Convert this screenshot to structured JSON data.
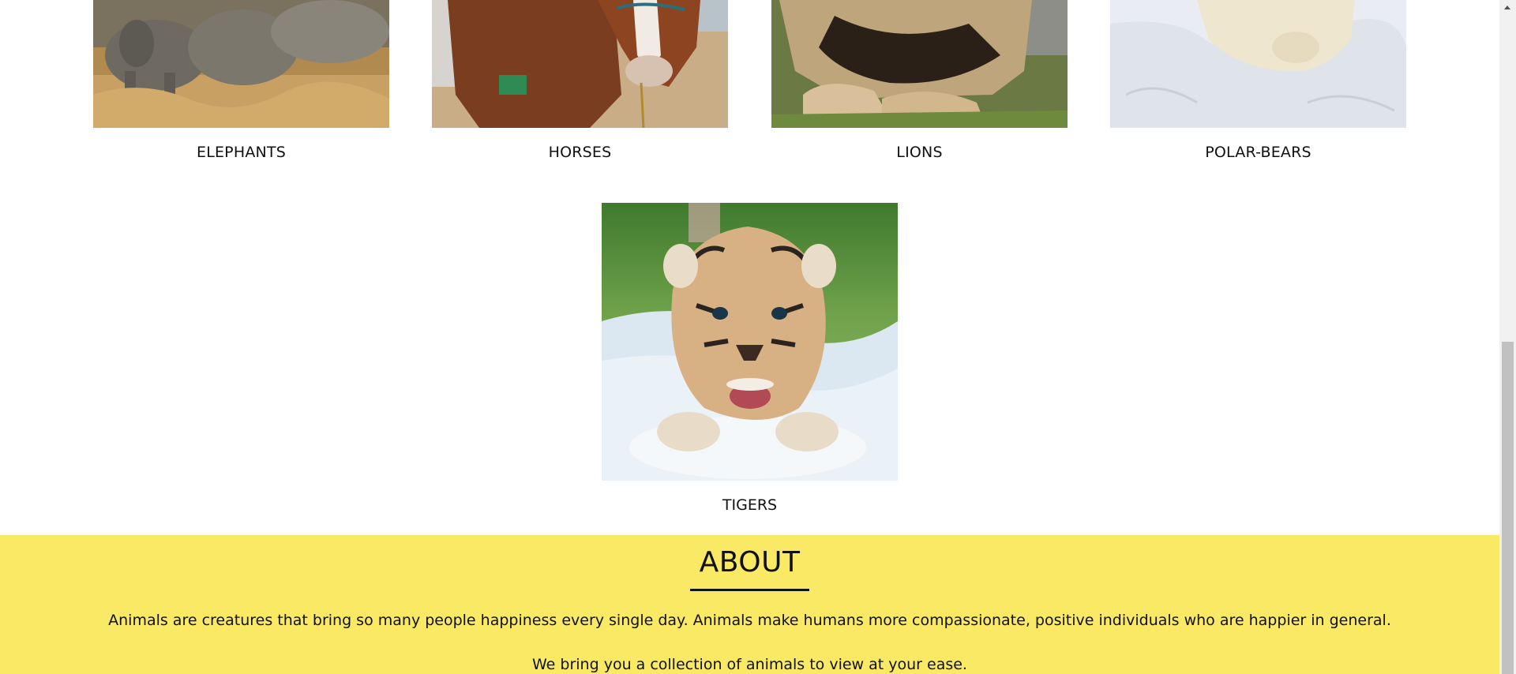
{
  "gallery": {
    "row": [
      {
        "label": "ELEPHANTS",
        "image": "elephants-photo"
      },
      {
        "label": "HORSES",
        "image": "horse-photo"
      },
      {
        "label": "LIONS",
        "image": "lion-photo"
      },
      {
        "label": "POLAR-BEARS",
        "image": "polar-bear-photo"
      }
    ],
    "featured": {
      "label": "TIGERS",
      "image": "tiger-cub-photo"
    }
  },
  "about": {
    "title": "ABOUT",
    "paragraph1": "Animals are creatures that bring so many people happiness every single day. Animals make humans more compassionate, positive individuals who are happier in general.",
    "paragraph2": "We bring you a collection of animals to view at your ease.",
    "background_color": "#f9e965"
  }
}
